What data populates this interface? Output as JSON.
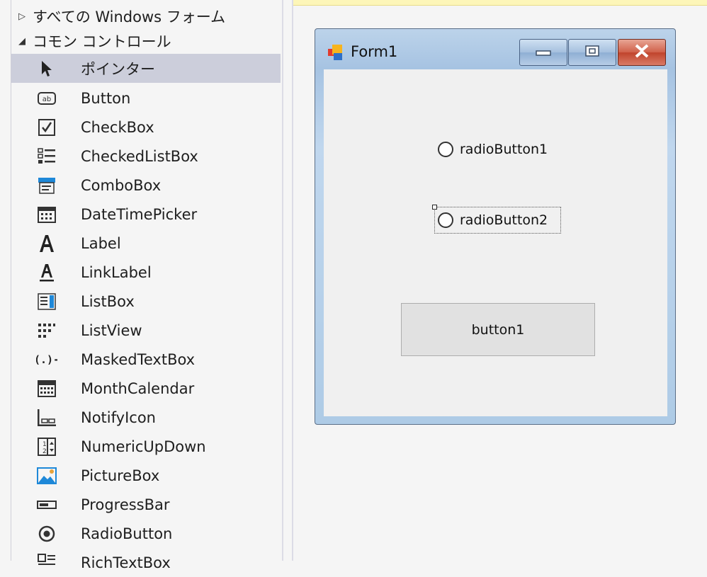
{
  "toolbox": {
    "group_all": "すべての Windows フォーム",
    "group_common": "コモン コントロール",
    "items": [
      {
        "label": "ポインター",
        "icon": "pointer-icon",
        "selected": true
      },
      {
        "label": "Button",
        "icon": "button-icon"
      },
      {
        "label": "CheckBox",
        "icon": "checkbox-icon"
      },
      {
        "label": "CheckedListBox",
        "icon": "checkedlistbox-icon"
      },
      {
        "label": "ComboBox",
        "icon": "combobox-icon"
      },
      {
        "label": "DateTimePicker",
        "icon": "datetimepicker-icon"
      },
      {
        "label": "Label",
        "icon": "label-icon"
      },
      {
        "label": "LinkLabel",
        "icon": "linklabel-icon"
      },
      {
        "label": "ListBox",
        "icon": "listbox-icon"
      },
      {
        "label": "ListView",
        "icon": "listview-icon"
      },
      {
        "label": "MaskedTextBox",
        "icon": "maskedtextbox-icon"
      },
      {
        "label": "MonthCalendar",
        "icon": "monthcalendar-icon"
      },
      {
        "label": "NotifyIcon",
        "icon": "notifyicon-icon"
      },
      {
        "label": "NumericUpDown",
        "icon": "numericupdown-icon"
      },
      {
        "label": "PictureBox",
        "icon": "picturebox-icon"
      },
      {
        "label": "ProgressBar",
        "icon": "progressbar-icon"
      },
      {
        "label": "RadioButton",
        "icon": "radiobutton-icon"
      },
      {
        "label": "RichTextBox",
        "icon": "richtextbox-icon"
      }
    ]
  },
  "form": {
    "title": "Form1",
    "radio1": "radioButton1",
    "radio2": "radioButton2",
    "button1": "button1"
  },
  "colors": {
    "selection": "#cccedb",
    "tab_strip": "#fdf6b9",
    "close_button": "#c0442c"
  }
}
